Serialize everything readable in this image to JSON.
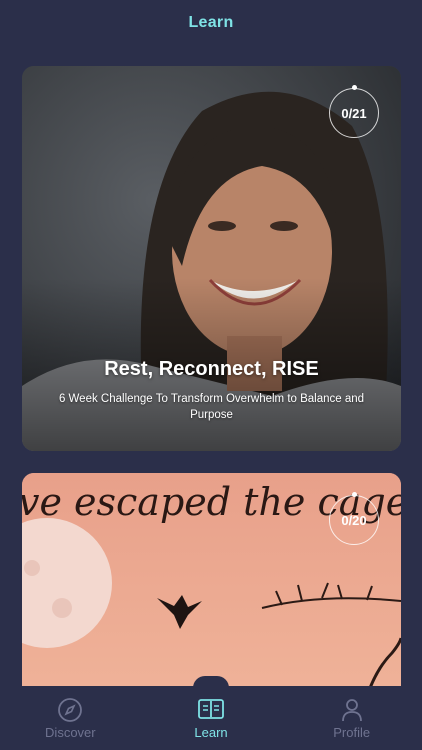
{
  "header": {
    "title": "Learn"
  },
  "cards": [
    {
      "title": "Rest, Reconnect, RISE",
      "subtitle": "6 Week Challenge To Transform Overwhelm to Balance and Purpose",
      "progress": "0/21"
    },
    {
      "title": "",
      "image_text": "ve escaped the cage",
      "progress": "0/20"
    }
  ],
  "tabs": [
    {
      "label": "Discover",
      "icon": "compass-icon",
      "active": false
    },
    {
      "label": "Learn",
      "icon": "book-icon",
      "active": true
    },
    {
      "label": "Profile",
      "icon": "user-icon",
      "active": false
    }
  ],
  "colors": {
    "background": "#2b2f4a",
    "accent": "#7fe3e6",
    "inactive": "#6f7390"
  }
}
